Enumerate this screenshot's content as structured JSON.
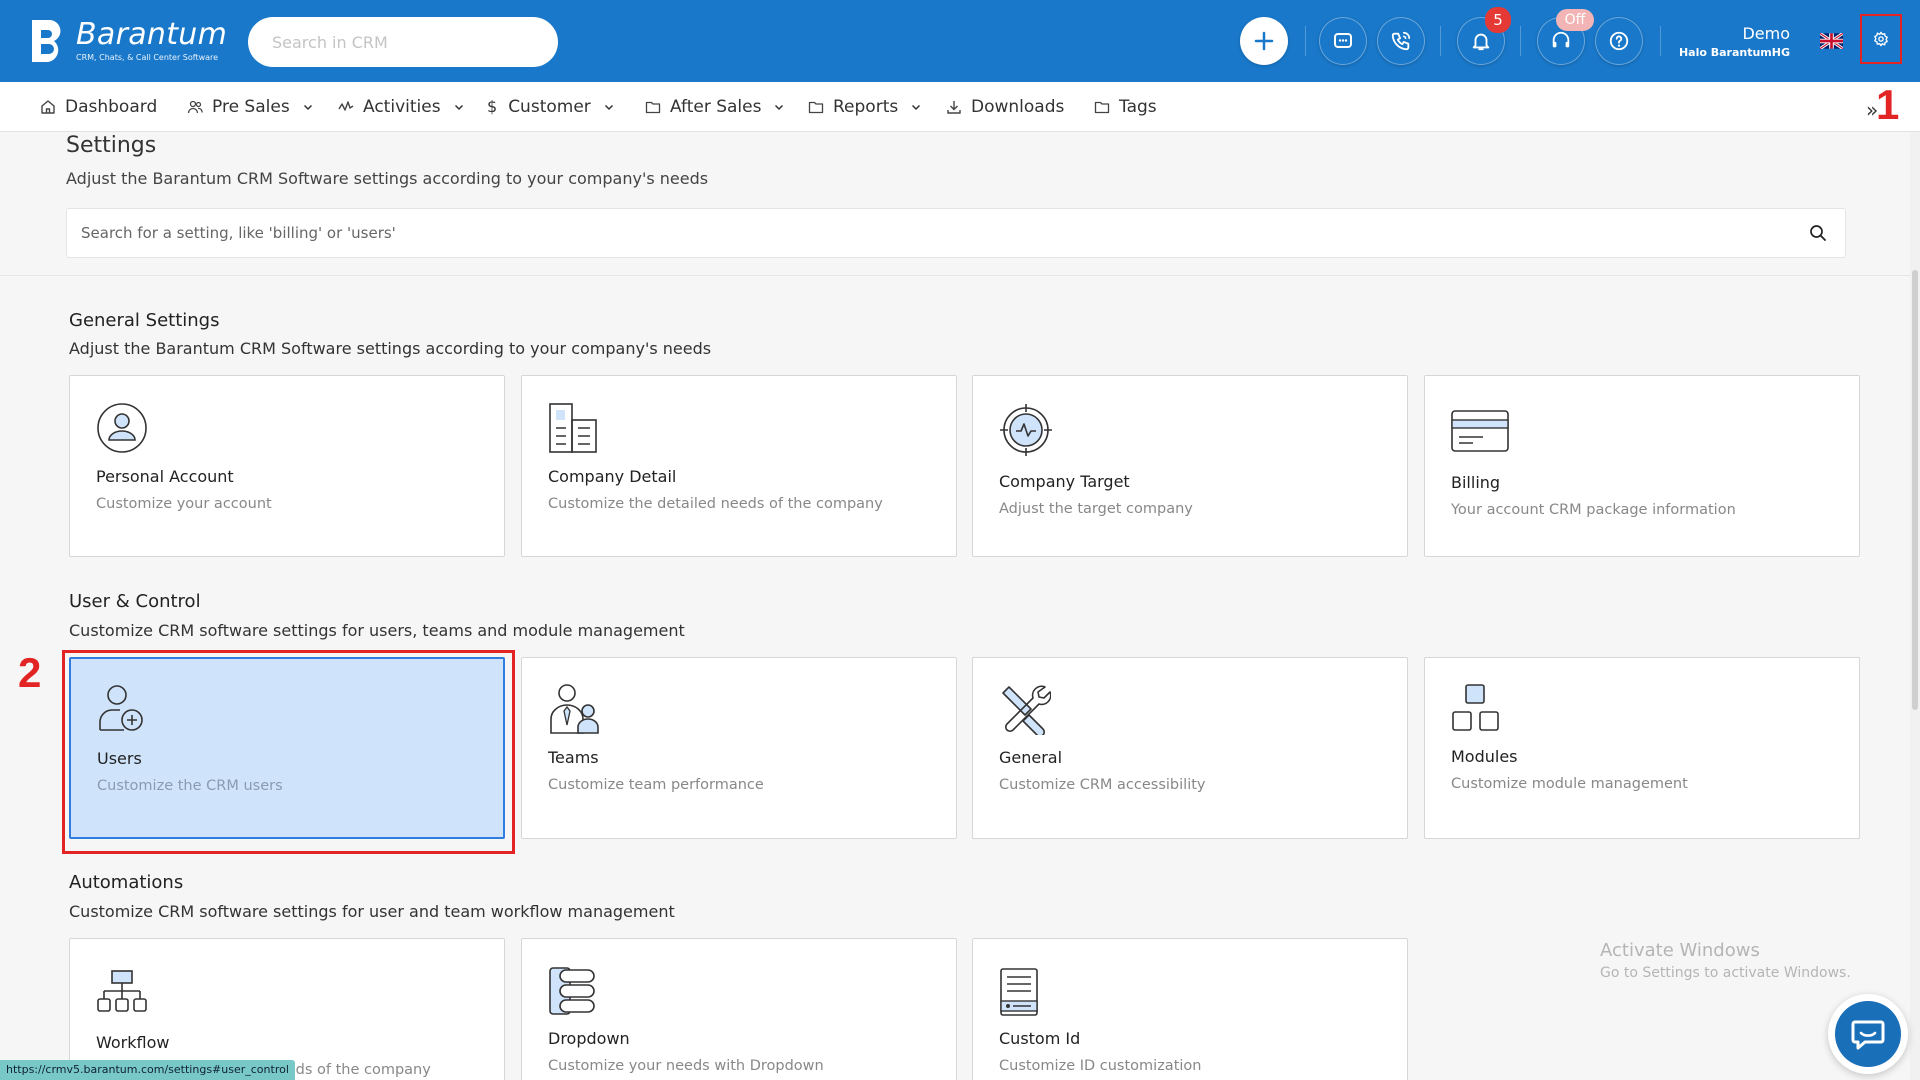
{
  "app": {
    "logo_name": "Barantum",
    "logo_tagline": "CRM, Chats, & Call Center Software",
    "search_placeholder": "Search in CRM",
    "notification_count": "5",
    "call_status": "Off",
    "user_name": "Demo",
    "user_company": "Halo BarantumHG",
    "accent_color": "#1978c9"
  },
  "nav": {
    "items": [
      {
        "label": "Dashboard",
        "icon": "home-icon",
        "dropdown": false
      },
      {
        "label": "Pre Sales",
        "icon": "users-icon",
        "dropdown": true
      },
      {
        "label": "Activities",
        "icon": "activity-icon",
        "dropdown": true
      },
      {
        "label": "Customer",
        "icon": "dollar-icon",
        "dropdown": true
      },
      {
        "label": "After Sales",
        "icon": "folder-icon",
        "dropdown": true
      },
      {
        "label": "Reports",
        "icon": "folder-icon",
        "dropdown": true
      },
      {
        "label": "Downloads",
        "icon": "download-icon",
        "dropdown": false
      },
      {
        "label": "Tags",
        "icon": "folder-icon",
        "dropdown": false
      }
    ],
    "more": "»"
  },
  "annotations": {
    "one": "1",
    "two": "2"
  },
  "settings": {
    "title": "Settings",
    "subtitle": "Adjust the Barantum CRM Software settings according to your company's needs",
    "search_placeholder": "Search for a setting, like 'billing' or 'users'"
  },
  "sections": [
    {
      "title": "General Settings",
      "subtitle": "Adjust the Barantum CRM Software settings according to your company's needs",
      "cards": [
        {
          "title": "Personal Account",
          "desc": "Customize your account",
          "icon": "user-circle-icon"
        },
        {
          "title": "Company Detail",
          "desc": "Customize the detailed needs of the company",
          "icon": "building-icon"
        },
        {
          "title": "Company Target",
          "desc": "Adjust the target company",
          "icon": "target-icon"
        },
        {
          "title": "Billing",
          "desc": "Your account CRM package information",
          "icon": "credit-card-icon"
        }
      ]
    },
    {
      "title": "User & Control",
      "subtitle": "Customize CRM software settings for users, teams and module management",
      "cards": [
        {
          "title": "Users",
          "desc": "Customize the CRM users",
          "icon": "user-add-icon",
          "active": true
        },
        {
          "title": "Teams",
          "desc": "Customize team performance",
          "icon": "team-icon"
        },
        {
          "title": "General",
          "desc": "Customize CRM accessibility",
          "icon": "tools-icon"
        },
        {
          "title": "Modules",
          "desc": "Customize module management",
          "icon": "modules-icon"
        }
      ]
    },
    {
      "title": "Automations",
      "subtitle": "Customize CRM software settings for user and team workflow management",
      "cards": [
        {
          "title": "Workflow",
          "desc": "Customize the detailed needs of the company",
          "icon": "workflow-icon"
        },
        {
          "title": "Dropdown",
          "desc": "Customize your needs with Dropdown",
          "icon": "dropdown-list-icon"
        },
        {
          "title": "Custom Id",
          "desc": "Customize ID customization",
          "icon": "custom-id-icon"
        }
      ]
    }
  ],
  "watermark": {
    "line1": "Activate Windows",
    "line2": "Go to Settings to activate Windows."
  },
  "status_url": "https://crmv5.barantum.com/settings#user_control"
}
